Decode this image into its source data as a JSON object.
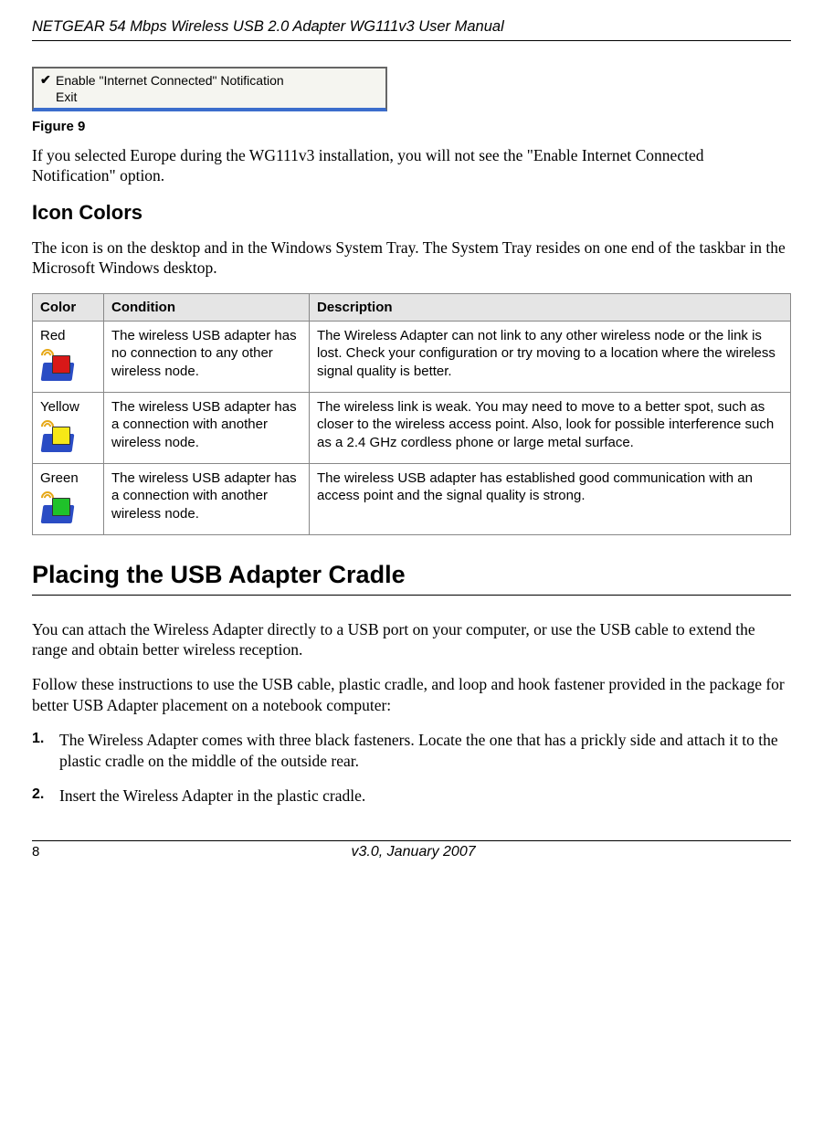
{
  "header": {
    "title": "NETGEAR 54 Mbps Wireless USB 2.0 Adapter WG111v3 User Manual"
  },
  "context_menu": {
    "item1": "Enable \"Internet Connected\" Notification",
    "item2": "Exit"
  },
  "figure_label": "Figure 9",
  "paragraph1": "If you selected Europe during the WG111v3 installation, you will not see the \"Enable Internet Connected Notification\" option.",
  "heading_icon_colors": "Icon Colors",
  "paragraph2": "The icon is on the desktop and in the Windows System Tray. The System Tray resides on one end of the taskbar in the Microsoft Windows desktop.",
  "table": {
    "headers": {
      "color": "Color",
      "condition": "Condition",
      "description": "Description"
    },
    "rows": [
      {
        "color": "Red",
        "condition": "The wireless USB adapter has no connection to any other wireless node.",
        "description": "The Wireless Adapter can not link to any other wireless node or the link is lost. Check your configuration or try moving to a location where the wireless signal quality is better."
      },
      {
        "color": "Yellow",
        "condition": "The wireless USB adapter has a connection with another wireless node.",
        "description": "The wireless link is weak. You may need to move to a better spot, such as closer to the wireless access point. Also, look for possible interference such as a 2.4 GHz cordless phone or large metal surface."
      },
      {
        "color": "Green",
        "condition": "The wireless USB adapter has a connection with another wireless node.",
        "description": "The wireless USB adapter has established good communication with an access point and the signal quality is strong."
      }
    ]
  },
  "heading_cradle": "Placing the USB Adapter Cradle",
  "paragraph3": "You can attach the Wireless Adapter directly to a USB port on your computer, or use the USB cable to extend the range and obtain better wireless reception.",
  "paragraph4": "Follow these instructions to use the USB cable, plastic cradle, and loop and hook fastener provided in the package for better USB Adapter placement on a notebook computer:",
  "steps": [
    "The Wireless Adapter comes with three black fasteners. Locate the one that has a prickly side and attach it to the plastic cradle on the middle of the outside rear.",
    "Insert the Wireless Adapter in the plastic cradle."
  ],
  "footer": {
    "page": "8",
    "version": "v3.0, January 2007"
  }
}
